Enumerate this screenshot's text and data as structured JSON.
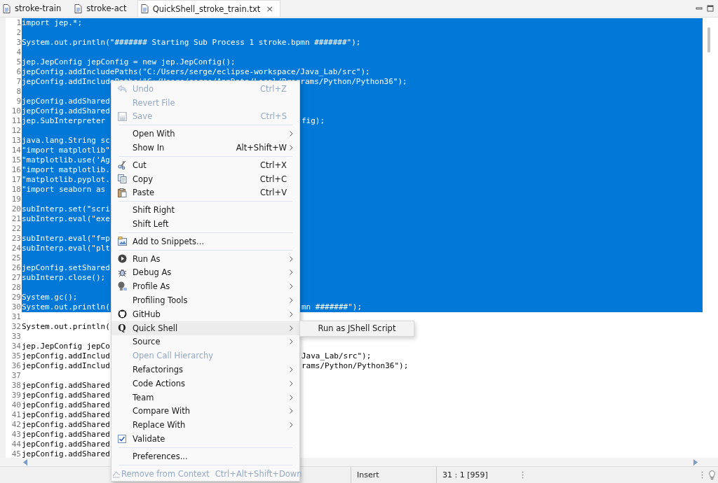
{
  "tabs": [
    {
      "label": "stroke-train",
      "selected": false
    },
    {
      "label": "stroke-act",
      "selected": false
    },
    {
      "label": "QuickShell_stroke_train.txt",
      "selected": true,
      "close": "×"
    }
  ],
  "editor": {
    "lines": [
      {
        "number": "1",
        "code": "import jep.*;",
        "selected": true
      },
      {
        "number": "2",
        "selected": true
      },
      {
        "number": "3",
        "code": "System.out.println(\"####### Starting Sub Process 1 stroke.bpmn #######\");",
        "selected": true
      },
      {
        "number": "4",
        "selected": true
      },
      {
        "number": "5",
        "code": "jep.JepConfig jepConfig = new jep.JepConfig();",
        "selected": true
      },
      {
        "number": "6",
        "code": "jepConfig.addIncludePaths(\"C:/Users/serge/eclipse-workspace/Java_Lab/src\");",
        "selected": true
      },
      {
        "number": "7",
        "code": "jepConfig.addIncludePaths(\"C:/Users/serge/AppData/Local/Programs/Python/Python36\");",
        "selected": true
      },
      {
        "number": "8",
        "selected": true
      },
      {
        "number": "9",
        "code": "jepConfig.addShared",
        "selected": true
      },
      {
        "number": "10",
        "code": "jepConfig.addShared",
        "selected": true
      },
      {
        "number": "11",
        "code": "jep.SubInterpreter",
        "code_right": "fig);",
        "selected": true
      },
      {
        "number": "12",
        "selected": true
      },
      {
        "number": "13",
        "code": "java.lang.String sc",
        "selected": true
      },
      {
        "number": "14",
        "code": "\"import matplotlib\"",
        "selected": true
      },
      {
        "number": "15",
        "code": "\"matplotlib.use('Ag",
        "selected": true
      },
      {
        "number": "16",
        "code": "\"import matplotlib.",
        "selected": true
      },
      {
        "number": "17",
        "code": "\"matplotlib.pyplot.",
        "selected": true
      },
      {
        "number": "18",
        "code": "\"import seaborn as",
        "selected": true
      },
      {
        "number": "19",
        "selected": true
      },
      {
        "number": "20",
        "code": "subInterp.set(\"scri",
        "selected": true
      },
      {
        "number": "21",
        "code": "subInterp.eval(\"exe",
        "selected": true
      },
      {
        "number": "22",
        "selected": true
      },
      {
        "number": "23",
        "code": "subInterp.eval(\"f=p",
        "selected": true
      },
      {
        "number": "24",
        "code": "subInterp.eval(\"plt",
        "selected": true
      },
      {
        "number": "25",
        "selected": true
      },
      {
        "number": "26",
        "code": "jepConfig.setShared",
        "selected": true
      },
      {
        "number": "27",
        "code": "subInterp.close();",
        "selected": true
      },
      {
        "number": "28",
        "selected": true
      },
      {
        "number": "29",
        "code": "System.gc();",
        "selected": true
      },
      {
        "number": "30",
        "code": "System.out.println(",
        "code_right": "mn #######\");",
        "selected": true
      },
      {
        "number": "31",
        "selected": false
      },
      {
        "number": "32",
        "code": "System.out.println(",
        "selected": false
      },
      {
        "number": "33",
        "selected": false
      },
      {
        "number": "34",
        "code": "jep.JepConfig jepCo",
        "selected": false
      },
      {
        "number": "35",
        "code": "jepConfig.addInclud",
        "code_right": "Java_Lab/src\");",
        "selected": false
      },
      {
        "number": "36",
        "code": "jepConfig.addInclud",
        "code_right": "rams/Python/Python36\");",
        "selected": false
      },
      {
        "number": "37",
        "selected": false
      },
      {
        "number": "38",
        "code": "jepConfig.addShared",
        "selected": false
      },
      {
        "number": "39",
        "code": "jepConfig.addShared",
        "selected": false
      },
      {
        "number": "40",
        "code": "jepConfig.addShared",
        "selected": false
      },
      {
        "number": "41",
        "code": "jepConfig.addShared",
        "selected": false
      },
      {
        "number": "42",
        "code": "jepConfig.addShared",
        "selected": false
      },
      {
        "number": "43",
        "code": "jepConfig.addShared",
        "selected": false
      },
      {
        "number": "44",
        "code": "jepConfig.addShared",
        "selected": false
      },
      {
        "number": "45",
        "code": "jepConfig.addShared",
        "selected": false
      }
    ]
  },
  "context_menu": {
    "items": [
      {
        "kind": "command",
        "label": "Undo",
        "shortcut": "Ctrl+Z",
        "submenu": false,
        "disabled": true,
        "selected": false
      },
      {
        "kind": "command",
        "label": "Revert File",
        "submenu": false,
        "disabled": true,
        "selected": false
      },
      {
        "kind": "command",
        "label": "Save",
        "shortcut": "Ctrl+S",
        "submenu": false,
        "disabled": true,
        "selected": false
      },
      {
        "kind": "separator"
      },
      {
        "kind": "command",
        "label": "Open With",
        "submenu": true,
        "disabled": false,
        "selected": false
      },
      {
        "kind": "command",
        "label": "Show In",
        "shortcut": "Alt+Shift+W",
        "submenu": true,
        "disabled": false,
        "selected": false
      },
      {
        "kind": "separator"
      },
      {
        "kind": "command",
        "label": "Cut",
        "shortcut": "Ctrl+X",
        "submenu": false,
        "disabled": false,
        "selected": false
      },
      {
        "kind": "command",
        "label": "Copy",
        "shortcut": "Ctrl+C",
        "submenu": false,
        "disabled": false,
        "selected": false
      },
      {
        "kind": "command",
        "label": "Paste",
        "shortcut": "Ctrl+V",
        "submenu": false,
        "disabled": false,
        "selected": false
      },
      {
        "kind": "separator"
      },
      {
        "kind": "command",
        "label": "Shift Right",
        "submenu": false,
        "disabled": false,
        "selected": false
      },
      {
        "kind": "command",
        "label": "Shift Left",
        "submenu": false,
        "disabled": false,
        "selected": false
      },
      {
        "kind": "separator"
      },
      {
        "kind": "command",
        "label": "Add to Snippets...",
        "submenu": false,
        "disabled": false,
        "selected": false
      },
      {
        "kind": "separator"
      },
      {
        "kind": "command",
        "label": "Run As",
        "submenu": true,
        "disabled": false,
        "selected": false
      },
      {
        "kind": "command",
        "label": "Debug As",
        "submenu": true,
        "disabled": false,
        "selected": false
      },
      {
        "kind": "command",
        "label": "Profile As",
        "submenu": true,
        "disabled": false,
        "selected": false
      },
      {
        "kind": "command",
        "label": "Profiling Tools",
        "submenu": true,
        "disabled": false,
        "selected": false
      },
      {
        "kind": "command",
        "label": "GitHub",
        "submenu": true,
        "disabled": false,
        "selected": false
      },
      {
        "kind": "command",
        "label": "Quick Shell",
        "glyph": "Q",
        "submenu": true,
        "disabled": false,
        "selected": true,
        "children": [
          {
            "label": "Run as JShell Script"
          }
        ]
      },
      {
        "kind": "command",
        "label": "Source",
        "submenu": true,
        "disabled": false,
        "selected": false
      },
      {
        "kind": "command",
        "label": "Open Call Hierarchy",
        "submenu": false,
        "disabled": true,
        "selected": false
      },
      {
        "kind": "command",
        "label": "Refactorings",
        "submenu": true,
        "disabled": false,
        "selected": false
      },
      {
        "kind": "command",
        "label": "Code Actions",
        "submenu": true,
        "disabled": false,
        "selected": false
      },
      {
        "kind": "command",
        "label": "Team",
        "submenu": true,
        "disabled": false,
        "selected": false
      },
      {
        "kind": "command",
        "label": "Compare With",
        "submenu": true,
        "disabled": false,
        "selected": false
      },
      {
        "kind": "command",
        "label": "Replace With",
        "submenu": true,
        "disabled": false,
        "selected": false
      },
      {
        "kind": "check",
        "label": "Validate",
        "checked": true,
        "submenu": false,
        "disabled": false,
        "selected": false
      },
      {
        "kind": "separator"
      },
      {
        "kind": "command",
        "label": "Preferences...",
        "submenu": false,
        "disabled": false,
        "selected": false
      },
      {
        "kind": "separator"
      },
      {
        "kind": "command",
        "label": "Remove from Context",
        "shortcut": "Ctrl+Alt+Shift+Down",
        "submenu": false,
        "disabled": true,
        "selected": false
      }
    ]
  },
  "status_bar": {
    "mode": "Insert",
    "position": "31 : 1 [959]"
  }
}
